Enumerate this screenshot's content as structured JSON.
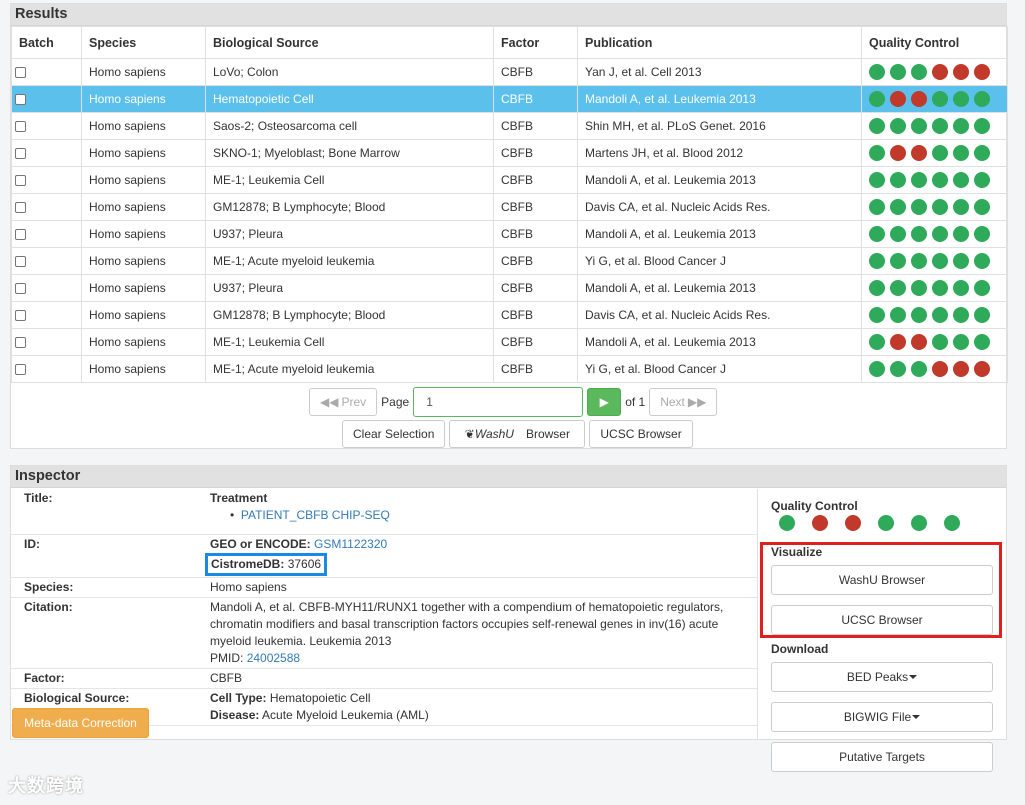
{
  "results": {
    "title": "Results",
    "columns": [
      "Batch",
      "Species",
      "Biological Source",
      "Factor",
      "Publication",
      "Quality Control"
    ],
    "rows": [
      {
        "species": "Homo sapiens",
        "source": "LoVo; Colon",
        "factor": "CBFB",
        "publication": "Yan J, et al. Cell 2013",
        "qc": [
          "g",
          "g",
          "g",
          "r",
          "r",
          "r"
        ]
      },
      {
        "species": "Homo sapiens",
        "source": "Hematopoietic Cell",
        "factor": "CBFB",
        "publication": "Mandoli A, et al. Leukemia 2013",
        "qc": [
          "g",
          "r",
          "r",
          "g",
          "g",
          "g"
        ],
        "selected": true
      },
      {
        "species": "Homo sapiens",
        "source": "Saos-2; Osteosarcoma cell",
        "factor": "CBFB",
        "publication": "Shin MH, et al. PLoS Genet. 2016",
        "qc": [
          "g",
          "g",
          "g",
          "g",
          "g",
          "g"
        ]
      },
      {
        "species": "Homo sapiens",
        "source": "SKNO-1; Myeloblast; Bone Marrow",
        "factor": "CBFB",
        "publication": "Martens JH, et al. Blood 2012",
        "qc": [
          "g",
          "r",
          "r",
          "g",
          "g",
          "g"
        ]
      },
      {
        "species": "Homo sapiens",
        "source": "ME-1; Leukemia Cell",
        "factor": "CBFB",
        "publication": "Mandoli A, et al. Leukemia 2013",
        "qc": [
          "g",
          "g",
          "g",
          "g",
          "g",
          "g"
        ]
      },
      {
        "species": "Homo sapiens",
        "source": "GM12878; B Lymphocyte; Blood",
        "factor": "CBFB",
        "publication": "Davis CA, et al. Nucleic Acids Res.",
        "qc": [
          "g",
          "g",
          "g",
          "g",
          "g",
          "g"
        ]
      },
      {
        "species": "Homo sapiens",
        "source": "U937; Pleura",
        "factor": "CBFB",
        "publication": "Mandoli A, et al. Leukemia 2013",
        "qc": [
          "g",
          "g",
          "g",
          "g",
          "g",
          "g"
        ]
      },
      {
        "species": "Homo sapiens",
        "source": "ME-1; Acute myeloid leukemia",
        "factor": "CBFB",
        "publication": "Yi G, et al. Blood Cancer J",
        "qc": [
          "g",
          "g",
          "g",
          "g",
          "g",
          "g"
        ]
      },
      {
        "species": "Homo sapiens",
        "source": "U937; Pleura",
        "factor": "CBFB",
        "publication": "Mandoli A, et al. Leukemia 2013",
        "qc": [
          "g",
          "g",
          "g",
          "g",
          "g",
          "g"
        ]
      },
      {
        "species": "Homo sapiens",
        "source": "GM12878; B Lymphocyte; Blood",
        "factor": "CBFB",
        "publication": "Davis CA, et al. Nucleic Acids Res.",
        "qc": [
          "g",
          "g",
          "g",
          "g",
          "g",
          "g"
        ]
      },
      {
        "species": "Homo sapiens",
        "source": "ME-1; Leukemia Cell",
        "factor": "CBFB",
        "publication": "Mandoli A, et al. Leukemia 2013",
        "qc": [
          "g",
          "r",
          "r",
          "g",
          "g",
          "g"
        ]
      },
      {
        "species": "Homo sapiens",
        "source": "ME-1; Acute myeloid leukemia",
        "factor": "CBFB",
        "publication": "Yi G, et al. Blood Cancer J",
        "qc": [
          "g",
          "g",
          "g",
          "r",
          "r",
          "r"
        ]
      }
    ],
    "pager": {
      "prev": "Prev",
      "page_label": "Page",
      "page_value": "1",
      "of_label": "of 1",
      "next": "Next"
    },
    "buttons": {
      "clear": "Clear Selection",
      "washu": "WashU",
      "washu_browser": "Browser",
      "ucsc": "UCSC Browser"
    }
  },
  "inspector": {
    "title": "Inspector",
    "title_label": "Title:",
    "treatment_label": "Treatment",
    "treatment_item": "PATIENT_CBFB CHIP-SEQ",
    "id_label": "ID:",
    "geo_label": "GEO or ENCODE:",
    "geo_value": "GSM1122320",
    "cistrome_label": "CistromeDB:",
    "cistrome_value": "37606",
    "species_label": "Species:",
    "species_value": "Homo sapiens",
    "citation_label": "Citation:",
    "citation_text": "Mandoli A, et al. CBFB-MYH11/RUNX1 together with a compendium of hematopoietic regulators, chromatin modifiers and basal transcription factors occupies self-renewal genes in inv(16) acute myeloid leukemia. Leukemia 2013",
    "pmid_label": "PMID:",
    "pmid_value": "24002588",
    "factor_label": "Factor:",
    "factor_value": "CBFB",
    "biosource_label": "Biological Source:",
    "celltype_label": "Cell Type:",
    "celltype_value": "Hematopoietic Cell",
    "disease_label": "Disease:",
    "disease_value": "Acute Myeloid Leukemia (AML)",
    "meta_button": "Meta-data Correction",
    "qc_label": "Quality Control",
    "qc": [
      "g",
      "r",
      "r",
      "g",
      "g",
      "g"
    ],
    "visualize_label": "Visualize",
    "washu_button": "WashU Browser",
    "ucsc_button": "UCSC Browser",
    "download_label": "Download",
    "bed_button": "BED Peaks",
    "bigwig_button": "BIGWIG File",
    "targets_button": "Putative Targets"
  },
  "watermark": "大数跨境",
  "colors": {
    "selected_row": "#5bc0eb",
    "qc_pass": "#2eaa5a",
    "qc_fail": "#c0392b",
    "highlight_box": "#e02020",
    "cistrome_box": "#1e88e5",
    "meta_button": "#f0ad4e"
  }
}
